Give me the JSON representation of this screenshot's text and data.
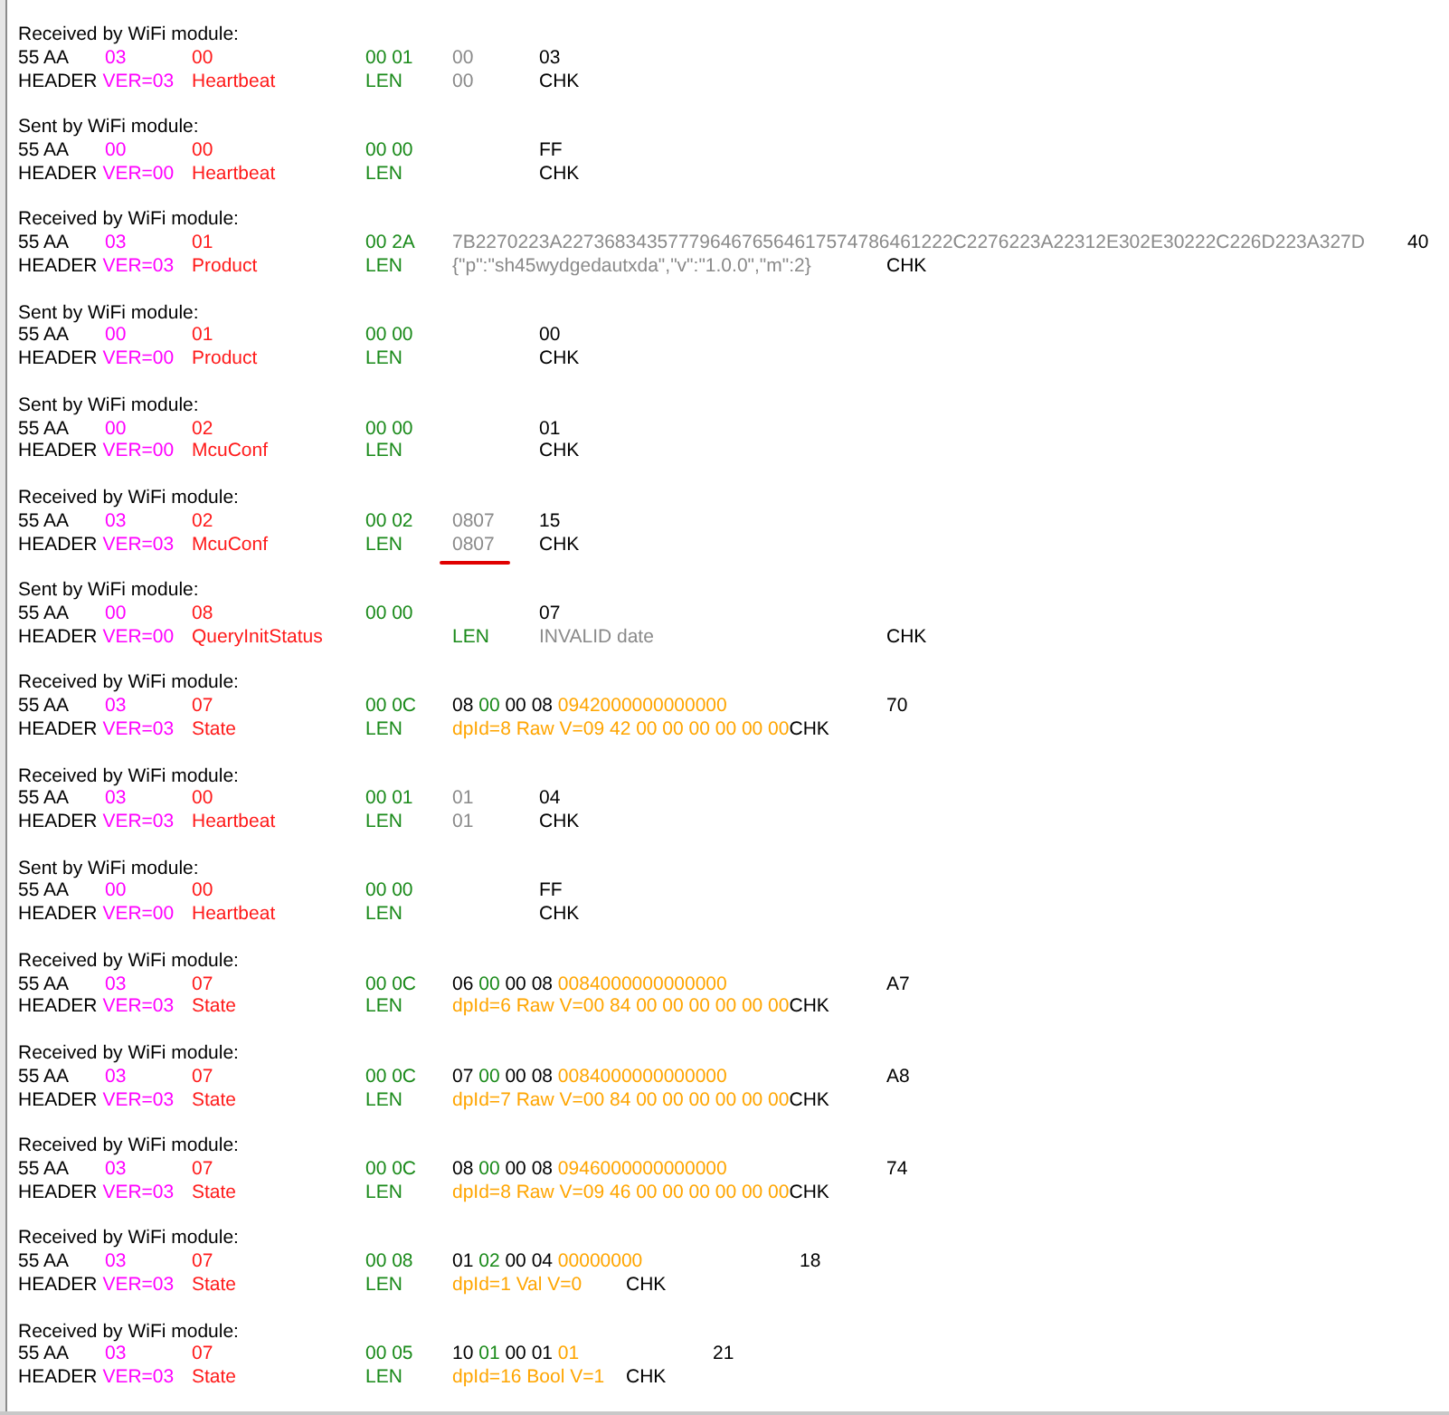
{
  "packets": [
    {
      "title": "Received by WiFi module:",
      "lines": [
        [
          {
            "text": "55 AA",
            "kind": "plain"
          },
          {
            "text": "\t03",
            "kind": "ver"
          },
          {
            "text": "\t00",
            "kind": "cmd"
          },
          {
            "text": "\t\t00 01",
            "kind": "len"
          },
          {
            "text": "\t00",
            "kind": "data"
          },
          {
            "text": "\t03",
            "kind": "plain"
          }
        ],
        [
          {
            "text": "HEADER",
            "kind": "plain"
          },
          {
            "text": " VER=03",
            "kind": "ver"
          },
          {
            "text": "\tHeartbeat",
            "kind": "cmd"
          },
          {
            "text": "\t\tLEN",
            "kind": "len"
          },
          {
            "text": "\t00",
            "kind": "data"
          },
          {
            "text": "\tCHK",
            "kind": "plain"
          }
        ]
      ]
    },
    {
      "title": "Sent by WiFi module:",
      "lines": [
        [
          {
            "text": "55 AA",
            "kind": "plain"
          },
          {
            "text": "\t00",
            "kind": "ver"
          },
          {
            "text": "\t00",
            "kind": "cmd"
          },
          {
            "text": "\t\t00 00",
            "kind": "len"
          },
          {
            "text": "\t\tFF",
            "kind": "plain"
          }
        ],
        [
          {
            "text": "HEADER",
            "kind": "plain"
          },
          {
            "text": " VER=00",
            "kind": "ver"
          },
          {
            "text": "\tHeartbeat",
            "kind": "cmd"
          },
          {
            "text": "\t\tLEN",
            "kind": "len"
          },
          {
            "text": "\t\tCHK",
            "kind": "plain"
          }
        ]
      ]
    },
    {
      "title": "Received by WiFi module:",
      "lines": [
        [
          {
            "text": "55 AA",
            "kind": "plain"
          },
          {
            "text": "\t03",
            "kind": "ver"
          },
          {
            "text": "\t01",
            "kind": "cmd"
          },
          {
            "text": "\t\t00 2A",
            "kind": "len"
          },
          {
            "text": "\t7B2270223A2273683435777964676564617574786461222C2276223A22312E302E30222C226D223A327D",
            "kind": "data"
          },
          {
            "text": "\t40",
            "kind": "plain"
          }
        ],
        [
          {
            "text": "HEADER",
            "kind": "plain"
          },
          {
            "text": " VER=03",
            "kind": "ver"
          },
          {
            "text": "\tProduct",
            "kind": "cmd"
          },
          {
            "text": "\t\tLEN",
            "kind": "len"
          },
          {
            "text": "\t{\"p\":\"sh45wydgedautxda\",\"v\":\"1.0.0\",\"m\":2}",
            "kind": "data"
          },
          {
            "text": "\tCHK",
            "kind": "plain"
          }
        ]
      ]
    },
    {
      "title": "Sent by WiFi module:",
      "lines": [
        [
          {
            "text": "55 AA",
            "kind": "plain"
          },
          {
            "text": "\t00",
            "kind": "ver"
          },
          {
            "text": "\t01",
            "kind": "cmd"
          },
          {
            "text": "\t\t00 00",
            "kind": "len"
          },
          {
            "text": "\t\t00",
            "kind": "plain"
          }
        ],
        [
          {
            "text": "HEADER",
            "kind": "plain"
          },
          {
            "text": " VER=00",
            "kind": "ver"
          },
          {
            "text": "\tProduct",
            "kind": "cmd"
          },
          {
            "text": "\t\tLEN",
            "kind": "len"
          },
          {
            "text": "\t\tCHK",
            "kind": "plain"
          }
        ]
      ]
    },
    {
      "title": "Sent by WiFi module:",
      "lines": [
        [
          {
            "text": "55 AA",
            "kind": "plain"
          },
          {
            "text": "\t00",
            "kind": "ver"
          },
          {
            "text": "\t02",
            "kind": "cmd"
          },
          {
            "text": "\t\t00 00",
            "kind": "len"
          },
          {
            "text": "\t\t01",
            "kind": "plain"
          }
        ],
        [
          {
            "text": "HEADER",
            "kind": "plain"
          },
          {
            "text": " VER=00",
            "kind": "ver"
          },
          {
            "text": "\tMcuConf",
            "kind": "cmd"
          },
          {
            "text": "\t\tLEN",
            "kind": "len"
          },
          {
            "text": "\t\tCHK",
            "kind": "plain"
          }
        ]
      ]
    },
    {
      "title": "Received by WiFi module:",
      "lines": [
        [
          {
            "text": "55 AA",
            "kind": "plain"
          },
          {
            "text": "\t03",
            "kind": "ver"
          },
          {
            "text": "\t02",
            "kind": "cmd"
          },
          {
            "text": "\t\t00 02",
            "kind": "len"
          },
          {
            "text": "\t0807",
            "kind": "data"
          },
          {
            "text": "\t15",
            "kind": "plain"
          }
        ],
        [
          {
            "text": "HEADER",
            "kind": "plain"
          },
          {
            "text": " VER=03",
            "kind": "ver"
          },
          {
            "text": "\tMcuConf",
            "kind": "cmd"
          },
          {
            "text": "\t\tLEN",
            "kind": "len"
          },
          {
            "text": "\t0807",
            "kind": "data",
            "marked": true
          },
          {
            "text": "\tCHK",
            "kind": "plain"
          }
        ]
      ]
    },
    {
      "title": "Sent by WiFi module:",
      "lines": [
        [
          {
            "text": "55 AA",
            "kind": "plain"
          },
          {
            "text": "\t00",
            "kind": "ver"
          },
          {
            "text": "\t08",
            "kind": "cmd"
          },
          {
            "text": "\t\t00 00",
            "kind": "len"
          },
          {
            "text": "\t\t07",
            "kind": "plain"
          }
        ],
        [
          {
            "text": "HEADER",
            "kind": "plain"
          },
          {
            "text": " VER=00",
            "kind": "ver"
          },
          {
            "text": "\tQueryInitStatus",
            "kind": "cmd"
          },
          {
            "text": "\t\tLEN",
            "kind": "len"
          },
          {
            "text": "\tINVALID date",
            "kind": "data"
          },
          {
            "text": "\t\t\tCHK",
            "kind": "plain"
          }
        ]
      ]
    },
    {
      "title": "Received by WiFi module:",
      "lines": [
        [
          {
            "text": "55 AA",
            "kind": "plain"
          },
          {
            "text": "\t03",
            "kind": "ver"
          },
          {
            "text": "\t07",
            "kind": "cmd"
          },
          {
            "text": "\t\t00 0C",
            "kind": "len"
          },
          {
            "text": "\t08",
            "kind": "plain"
          },
          {
            "text": " 00",
            "kind": "len"
          },
          {
            "text": " 00 08",
            "kind": "plain"
          },
          {
            "text": " 0942000000000000",
            "kind": "dp"
          },
          {
            "text": "\t\t70",
            "kind": "plain"
          }
        ],
        [
          {
            "text": "HEADER",
            "kind": "plain"
          },
          {
            "text": " VER=03",
            "kind": "ver"
          },
          {
            "text": "\tState",
            "kind": "cmd"
          },
          {
            "text": "\t\tLEN",
            "kind": "len"
          },
          {
            "text": "\tdpId=8 Raw V=09 42 00 00 00 00 00 00",
            "kind": "dp"
          },
          {
            "text": "CHK",
            "kind": "plain"
          }
        ]
      ]
    },
    {
      "title": "Received by WiFi module:",
      "lines": [
        [
          {
            "text": "55 AA",
            "kind": "plain"
          },
          {
            "text": "\t03",
            "kind": "ver"
          },
          {
            "text": "\t00",
            "kind": "cmd"
          },
          {
            "text": "\t\t00 01",
            "kind": "len"
          },
          {
            "text": "\t01",
            "kind": "data"
          },
          {
            "text": "\t04",
            "kind": "plain"
          }
        ],
        [
          {
            "text": "HEADER",
            "kind": "plain"
          },
          {
            "text": " VER=03",
            "kind": "ver"
          },
          {
            "text": "\tHeartbeat",
            "kind": "cmd"
          },
          {
            "text": "\t\tLEN",
            "kind": "len"
          },
          {
            "text": "\t01",
            "kind": "data"
          },
          {
            "text": "\tCHK",
            "kind": "plain"
          }
        ]
      ]
    },
    {
      "title": "Sent by WiFi module:",
      "lines": [
        [
          {
            "text": "55 AA",
            "kind": "plain"
          },
          {
            "text": "\t00",
            "kind": "ver"
          },
          {
            "text": "\t00",
            "kind": "cmd"
          },
          {
            "text": "\t\t00 00",
            "kind": "len"
          },
          {
            "text": "\t\tFF",
            "kind": "plain"
          }
        ],
        [
          {
            "text": "HEADER",
            "kind": "plain"
          },
          {
            "text": " VER=00",
            "kind": "ver"
          },
          {
            "text": "\tHeartbeat",
            "kind": "cmd"
          },
          {
            "text": "\t\tLEN",
            "kind": "len"
          },
          {
            "text": "\t\tCHK",
            "kind": "plain"
          }
        ]
      ]
    },
    {
      "title": "Received by WiFi module:",
      "lines": [
        [
          {
            "text": "55 AA",
            "kind": "plain"
          },
          {
            "text": "\t03",
            "kind": "ver"
          },
          {
            "text": "\t07",
            "kind": "cmd"
          },
          {
            "text": "\t\t00 0C",
            "kind": "len"
          },
          {
            "text": "\t06",
            "kind": "plain"
          },
          {
            "text": " 00",
            "kind": "len"
          },
          {
            "text": " 00 08",
            "kind": "plain"
          },
          {
            "text": " 0084000000000000",
            "kind": "dp"
          },
          {
            "text": "\t\tA7",
            "kind": "plain"
          }
        ],
        [
          {
            "text": "HEADER",
            "kind": "plain"
          },
          {
            "text": " VER=03",
            "kind": "ver"
          },
          {
            "text": "\tState",
            "kind": "cmd"
          },
          {
            "text": "\t\tLEN",
            "kind": "len"
          },
          {
            "text": "\tdpId=6 Raw V=00 84 00 00 00 00 00 00",
            "kind": "dp"
          },
          {
            "text": "CHK",
            "kind": "plain"
          }
        ]
      ]
    },
    {
      "title": "Received by WiFi module:",
      "lines": [
        [
          {
            "text": "55 AA",
            "kind": "plain"
          },
          {
            "text": "\t03",
            "kind": "ver"
          },
          {
            "text": "\t07",
            "kind": "cmd"
          },
          {
            "text": "\t\t00 0C",
            "kind": "len"
          },
          {
            "text": "\t07",
            "kind": "plain"
          },
          {
            "text": " 00",
            "kind": "len"
          },
          {
            "text": " 00 08",
            "kind": "plain"
          },
          {
            "text": " 0084000000000000",
            "kind": "dp"
          },
          {
            "text": "\t\tA8",
            "kind": "plain"
          }
        ],
        [
          {
            "text": "HEADER",
            "kind": "plain"
          },
          {
            "text": " VER=03",
            "kind": "ver"
          },
          {
            "text": "\tState",
            "kind": "cmd"
          },
          {
            "text": "\t\tLEN",
            "kind": "len"
          },
          {
            "text": "\tdpId=7 Raw V=00 84 00 00 00 00 00 00",
            "kind": "dp"
          },
          {
            "text": "CHK",
            "kind": "plain"
          }
        ]
      ]
    },
    {
      "title": "Received by WiFi module:",
      "lines": [
        [
          {
            "text": "55 AA",
            "kind": "plain"
          },
          {
            "text": "\t03",
            "kind": "ver"
          },
          {
            "text": "\t07",
            "kind": "cmd"
          },
          {
            "text": "\t\t00 0C",
            "kind": "len"
          },
          {
            "text": "\t08",
            "kind": "plain"
          },
          {
            "text": " 00",
            "kind": "len"
          },
          {
            "text": " 00 08",
            "kind": "plain"
          },
          {
            "text": " 0946000000000000",
            "kind": "dp"
          },
          {
            "text": "\t\t74",
            "kind": "plain"
          }
        ],
        [
          {
            "text": "HEADER",
            "kind": "plain"
          },
          {
            "text": " VER=03",
            "kind": "ver"
          },
          {
            "text": "\tState",
            "kind": "cmd"
          },
          {
            "text": "\t\tLEN",
            "kind": "len"
          },
          {
            "text": "\tdpId=8 Raw V=09 46 00 00 00 00 00 00",
            "kind": "dp"
          },
          {
            "text": "CHK",
            "kind": "plain"
          }
        ]
      ]
    },
    {
      "title": "Received by WiFi module:",
      "lines": [
        [
          {
            "text": "55 AA",
            "kind": "plain"
          },
          {
            "text": "\t03",
            "kind": "ver"
          },
          {
            "text": "\t07",
            "kind": "cmd"
          },
          {
            "text": "\t\t00 08",
            "kind": "len"
          },
          {
            "text": "\t01",
            "kind": "plain"
          },
          {
            "text": " 02",
            "kind": "len"
          },
          {
            "text": " 00 04",
            "kind": "plain"
          },
          {
            "text": " 00000000",
            "kind": "dp"
          },
          {
            "text": "\t\t18",
            "kind": "plain"
          }
        ],
        [
          {
            "text": "HEADER",
            "kind": "plain"
          },
          {
            "text": " VER=03",
            "kind": "ver"
          },
          {
            "text": "\tState",
            "kind": "cmd"
          },
          {
            "text": "\t\tLEN",
            "kind": "len"
          },
          {
            "text": "\tdpId=1 Val V=0",
            "kind": "dp"
          },
          {
            "text": "\tCHK",
            "kind": "plain"
          }
        ]
      ]
    },
    {
      "title": "Received by WiFi module:",
      "lines": [
        [
          {
            "text": "55 AA",
            "kind": "plain"
          },
          {
            "text": "\t03",
            "kind": "ver"
          },
          {
            "text": "\t07",
            "kind": "cmd"
          },
          {
            "text": "\t\t00 05",
            "kind": "len"
          },
          {
            "text": "\t10",
            "kind": "plain"
          },
          {
            "text": " 01",
            "kind": "len"
          },
          {
            "text": " 00 01",
            "kind": "plain"
          },
          {
            "text": " 01",
            "kind": "dp"
          },
          {
            "text": "\t\t21",
            "kind": "plain"
          }
        ],
        [
          {
            "text": "HEADER",
            "kind": "plain"
          },
          {
            "text": " VER=03",
            "kind": "ver"
          },
          {
            "text": "\tState",
            "kind": "cmd"
          },
          {
            "text": "\t\tLEN",
            "kind": "len"
          },
          {
            "text": "\tdpId=16 Bool V=1",
            "kind": "dp"
          },
          {
            "text": "\tCHK",
            "kind": "plain"
          }
        ]
      ]
    }
  ]
}
